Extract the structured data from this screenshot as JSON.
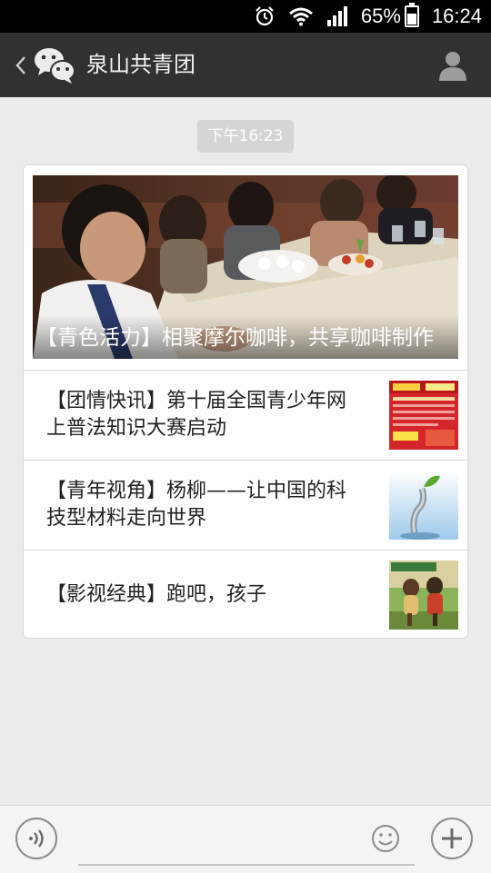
{
  "status_bar": {
    "battery_percent": "65%",
    "time": "16:24",
    "icons": [
      "alarm-icon",
      "wifi-icon",
      "signal-icon",
      "battery-icon"
    ]
  },
  "header": {
    "title": "泉山共青团",
    "back_icon": "chevron-left-icon",
    "logo_icon": "wechat-icon",
    "profile_icon": "person-icon"
  },
  "timestamp": "下午16:23",
  "article_card": {
    "cover": {
      "title": "【青色活力】相聚摩尔咖啡，共享咖啡制作"
    },
    "items": [
      {
        "title": "【团情快讯】第十届全国青少年网上普法知识大赛启动"
      },
      {
        "title": "【青年视角】杨柳——让中国的科技型材料走向世界"
      },
      {
        "title": "【影视经典】跑吧，孩子"
      }
    ]
  },
  "input_bar": {
    "voice_icon": "voice-icon",
    "emoji_icon": "emoji-icon",
    "plus_icon": "plus-icon"
  }
}
